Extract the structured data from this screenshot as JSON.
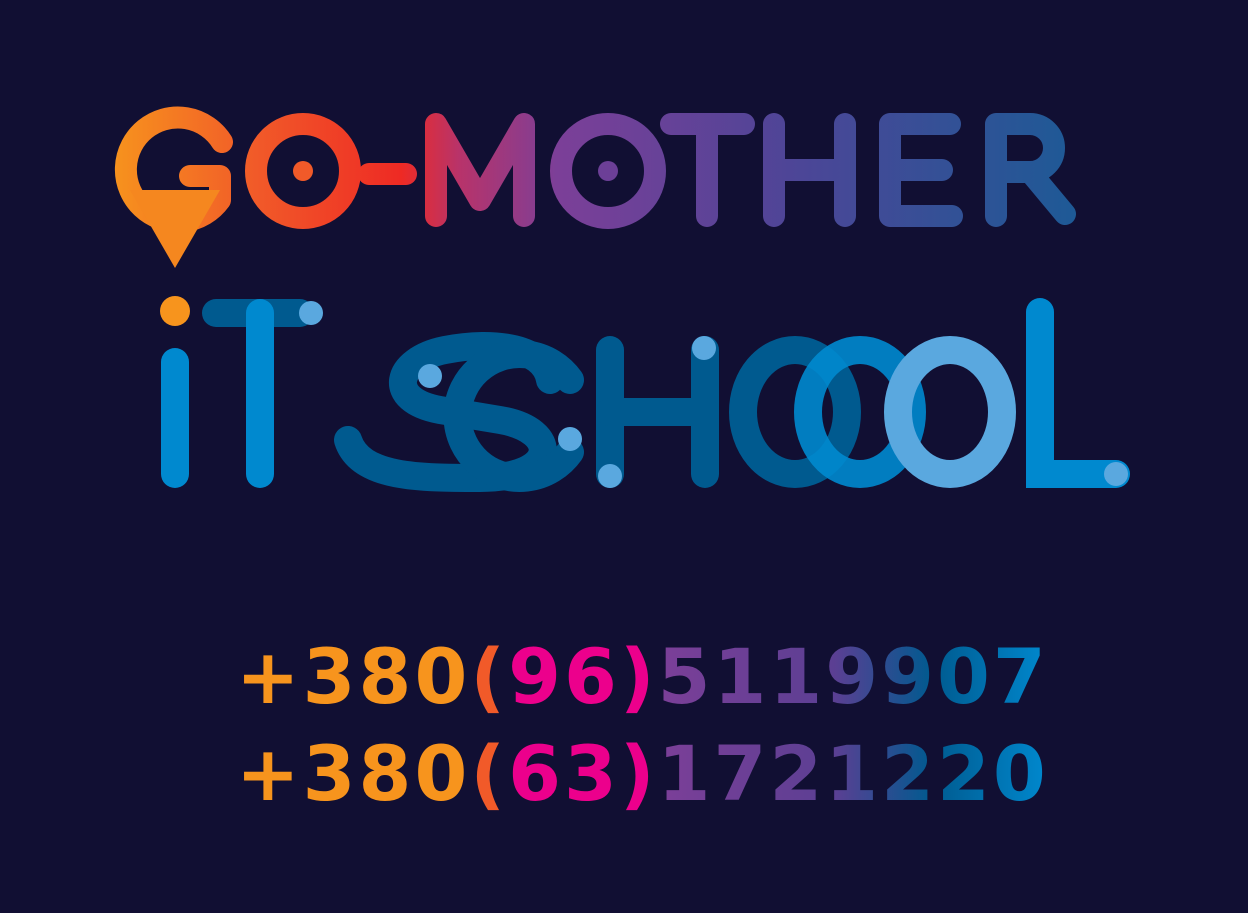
{
  "brand": {
    "line1": "GO-MOTHER",
    "line2": "iT SCHOOL",
    "colors": {
      "background": "#110f33",
      "orange": "#f7941d",
      "orange_red": "#f15a29",
      "red": "#ee2a24",
      "magenta": "#ec008c",
      "purple": "#7c3f98",
      "indigo": "#5b3f93",
      "navy_blue": "#1d5a96",
      "dark_blue": "#005a8f",
      "blue": "#0089cf",
      "light_blue": "#5aa8df"
    }
  },
  "phones": [
    {
      "prefix": "+380",
      "open": "(",
      "code": "96",
      "close": ")",
      "number": "5119907"
    },
    {
      "prefix": "+380",
      "open": "(",
      "code": "63",
      "close": ")",
      "number": "1721220"
    }
  ]
}
